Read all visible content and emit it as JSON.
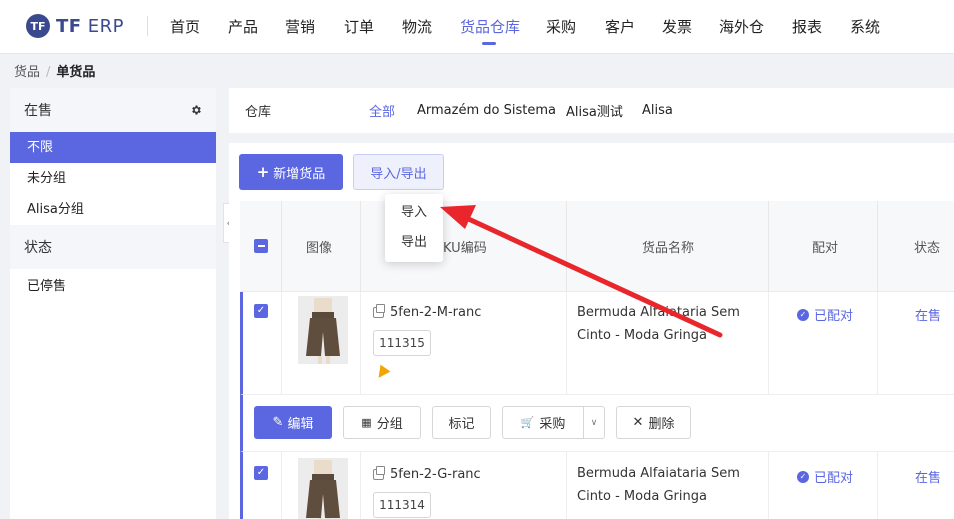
{
  "app": {
    "logo_mark": "TF",
    "logo_bold": "TF",
    "logo_rest": " ERP"
  },
  "nav": [
    "首页",
    "产品",
    "营销",
    "订单",
    "物流",
    "货品仓库",
    "采购",
    "客户",
    "发票",
    "海外仓",
    "报表",
    "系统"
  ],
  "nav_active": "货品仓库",
  "breadcrumb": {
    "root": "货品",
    "sep": "/",
    "current": "单货品"
  },
  "sidebar": {
    "section1_title": "在售",
    "items": [
      "不限",
      "未分组",
      "Alisa分组"
    ],
    "section2_title": "状态",
    "items2": [
      "已停售"
    ]
  },
  "warehouse": {
    "label": "仓库",
    "options": [
      "全部",
      "Armazém do Sistema",
      "Alisa测试",
      "Alisa"
    ]
  },
  "toolbar": {
    "add_label": "新增货品",
    "import_export_label": "导入/导出"
  },
  "dropdown": {
    "import": "导入",
    "export": "导出"
  },
  "table": {
    "headers": {
      "image": "图像",
      "sku": "KU编码",
      "name": "货品名称",
      "paired": "配对",
      "status": "状态"
    },
    "rows": [
      {
        "sku": "5fen-2-M-ranc",
        "code": "111315",
        "name": "Bermuda Alfaiataria Sem Cinto - Moda Gringa",
        "paired": "已配对",
        "status": "在售"
      },
      {
        "sku": "5fen-2-G-ranc",
        "code": "111314",
        "name": "Bermuda Alfaiataria Sem Cinto - Moda Gringa",
        "paired": "已配对",
        "status": "在售"
      }
    ]
  },
  "row_actions": {
    "edit": "编辑",
    "group": "分组",
    "tag": "标记",
    "purchase": "采购",
    "delete": "删除"
  },
  "colors": {
    "accent": "#5b67e0",
    "arrow": "#e8262b"
  }
}
